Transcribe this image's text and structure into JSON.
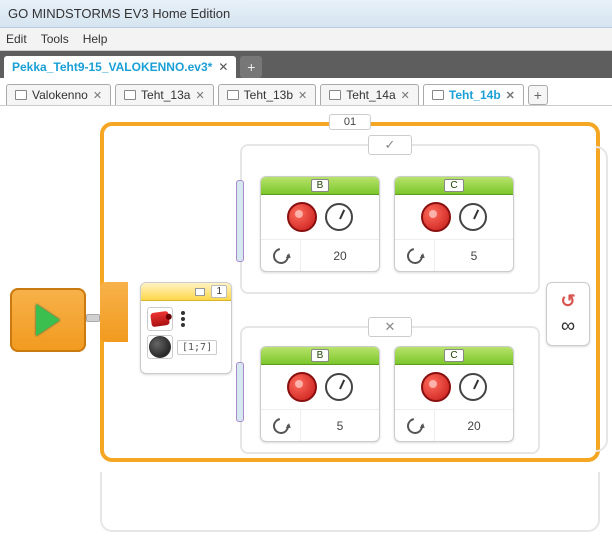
{
  "title": "GO MINDSTORMS EV3 Home Edition",
  "menu": {
    "edit": "Edit",
    "tools": "Tools",
    "help": "Help"
  },
  "project": {
    "name": "Pekka_Teht9-15_VALOKENNO.ev3*"
  },
  "programs": [
    {
      "label": "Valokenno",
      "active": false
    },
    {
      "label": "Teht_13a",
      "active": false
    },
    {
      "label": "Teht_13b",
      "active": false
    },
    {
      "label": "Teht_14a",
      "active": false
    },
    {
      "label": "Teht_14b",
      "active": true
    }
  ],
  "loop": {
    "label": "01"
  },
  "switch": {
    "port": "1",
    "threshold": "[1;7]"
  },
  "case_true": {
    "symbol": "✓",
    "motors": [
      {
        "port": "B",
        "power": "20"
      },
      {
        "port": "C",
        "power": "5"
      }
    ]
  },
  "case_false": {
    "symbol": "✕",
    "motors": [
      {
        "port": "B",
        "power": "5"
      },
      {
        "port": "C",
        "power": "20"
      }
    ]
  },
  "loop_end": {
    "symbol": "∞"
  }
}
